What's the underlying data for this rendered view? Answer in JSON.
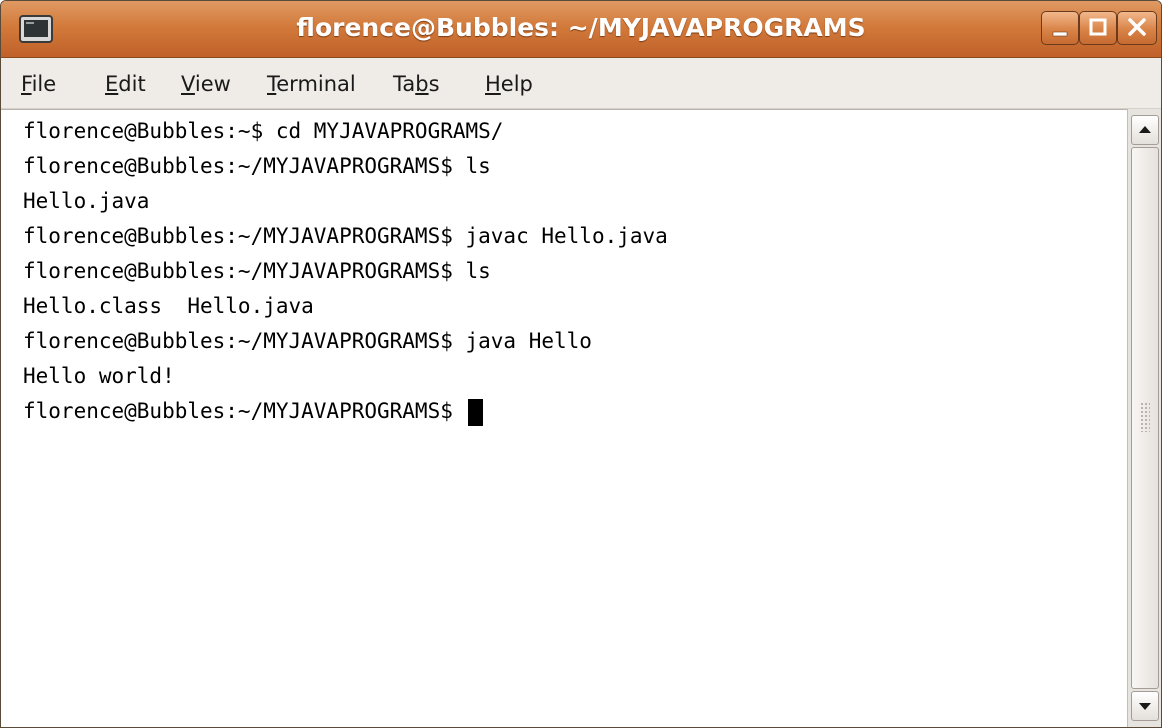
{
  "window": {
    "title": "florence@Bubbles: ~/MYJAVAPROGRAMS",
    "icon": "terminal-icon",
    "controls": [
      "minimize-icon",
      "maximize-icon",
      "close-icon"
    ]
  },
  "menu": [
    {
      "mnemonic": "F",
      "rest": "ile"
    },
    {
      "mnemonic": "E",
      "rest": "dit"
    },
    {
      "mnemonic": "V",
      "rest": "iew"
    },
    {
      "mnemonic": "T",
      "rest": "erminal"
    },
    {
      "pre": "Ta",
      "mnemonic": "b",
      "rest": "s"
    },
    {
      "mnemonic": "H",
      "rest": "elp"
    }
  ],
  "terminal": {
    "lines": [
      "florence@Bubbles:~$ cd MYJAVAPROGRAMS/",
      "florence@Bubbles:~/MYJAVAPROGRAMS$ ls",
      "Hello.java",
      "florence@Bubbles:~/MYJAVAPROGRAMS$ javac Hello.java",
      "florence@Bubbles:~/MYJAVAPROGRAMS$ ls",
      "Hello.class  Hello.java",
      "florence@Bubbles:~/MYJAVAPROGRAMS$ java Hello",
      "Hello world!",
      "florence@Bubbles:~/MYJAVAPROGRAMS$ "
    ]
  },
  "colors": {
    "titlebar": "#d27a3b",
    "terminal_bg": "#ffffff",
    "terminal_fg": "#000000",
    "chrome_bg": "#efebe7"
  }
}
